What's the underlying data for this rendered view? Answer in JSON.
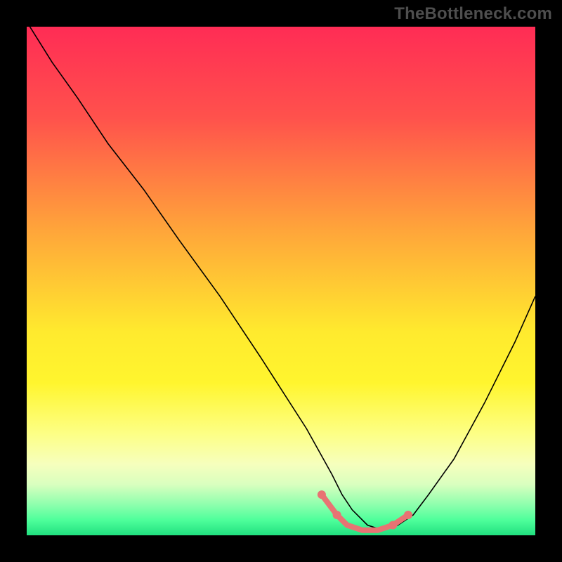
{
  "attribution": "TheBottleneck.com",
  "chart_data": {
    "type": "line",
    "title": "",
    "xlabel": "",
    "ylabel": "",
    "xlim": [
      0,
      1
    ],
    "ylim": [
      0,
      1
    ],
    "gradient_stops": [
      {
        "offset": 0.0,
        "color": "#ff2c55"
      },
      {
        "offset": 0.18,
        "color": "#ff524c"
      },
      {
        "offset": 0.4,
        "color": "#ffa53a"
      },
      {
        "offset": 0.6,
        "color": "#ffea2e"
      },
      {
        "offset": 0.7,
        "color": "#fff52e"
      },
      {
        "offset": 0.8,
        "color": "#fdff85"
      },
      {
        "offset": 0.86,
        "color": "#f6ffbd"
      },
      {
        "offset": 0.9,
        "color": "#d9ffbf"
      },
      {
        "offset": 0.94,
        "color": "#8dffad"
      },
      {
        "offset": 0.97,
        "color": "#4eff9b"
      },
      {
        "offset": 1.0,
        "color": "#21e07f"
      }
    ],
    "series": [
      {
        "name": "bottleneck-curve",
        "x": [
          0.0,
          0.05,
          0.1,
          0.16,
          0.23,
          0.3,
          0.38,
          0.46,
          0.55,
          0.6,
          0.62,
          0.64,
          0.67,
          0.7,
          0.73,
          0.76,
          0.79,
          0.84,
          0.9,
          0.96,
          1.0
        ],
        "y": [
          1.01,
          0.93,
          0.86,
          0.77,
          0.68,
          0.58,
          0.47,
          0.35,
          0.21,
          0.12,
          0.08,
          0.05,
          0.02,
          0.01,
          0.02,
          0.04,
          0.08,
          0.15,
          0.26,
          0.38,
          0.47
        ]
      }
    ],
    "highlight": {
      "name": "optimal-range",
      "x": [
        0.58,
        0.61,
        0.63,
        0.66,
        0.69,
        0.72,
        0.75
      ],
      "y": [
        0.08,
        0.04,
        0.02,
        0.01,
        0.01,
        0.02,
        0.04
      ],
      "dots_x": [
        0.58,
        0.61,
        0.72,
        0.75
      ],
      "dots_y": [
        0.08,
        0.04,
        0.02,
        0.04
      ]
    }
  }
}
